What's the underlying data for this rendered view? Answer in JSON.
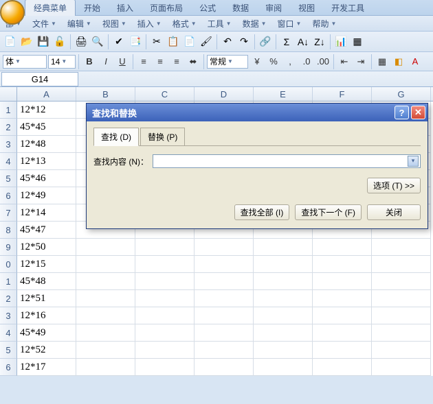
{
  "ribbon_tabs": [
    "经典菜单",
    "开始",
    "插入",
    "页面布局",
    "公式",
    "数据",
    "审阅",
    "视图",
    "开发工具"
  ],
  "active_ribbon_tab": 0,
  "menu": {
    "all": "部",
    "file": "文件",
    "edit": "编辑",
    "view": "视图",
    "insert": "插入",
    "format": "格式",
    "tools": "工具",
    "data": "数据",
    "window": "窗口",
    "help": "帮助"
  },
  "format_bar": {
    "font": "体",
    "size": "14",
    "style_combo": "常规"
  },
  "name_box": "G14",
  "columns": [
    "A",
    "B",
    "C",
    "D",
    "E",
    "F",
    "G"
  ],
  "rows": [
    {
      "n": "1",
      "a": "12*12"
    },
    {
      "n": "2",
      "a": "45*45"
    },
    {
      "n": "3",
      "a": "12*48"
    },
    {
      "n": "4",
      "a": "12*13"
    },
    {
      "n": "5",
      "a": "45*46"
    },
    {
      "n": "6",
      "a": "12*49"
    },
    {
      "n": "7",
      "a": "12*14"
    },
    {
      "n": "8",
      "a": "45*47"
    },
    {
      "n": "9",
      "a": "12*50"
    },
    {
      "n": "0",
      "a": "12*15"
    },
    {
      "n": "1",
      "a": "45*48"
    },
    {
      "n": "2",
      "a": "12*51"
    },
    {
      "n": "3",
      "a": "12*16"
    },
    {
      "n": "4",
      "a": "45*49"
    },
    {
      "n": "5",
      "a": "12*52"
    },
    {
      "n": "6",
      "a": "12*17"
    }
  ],
  "dialog": {
    "title": "查找和替换",
    "tab_find": "查找 (D)",
    "tab_replace": "替换 (P)",
    "find_label": "查找内容 (N)：",
    "options_btn": "选项 (T) >>",
    "find_all_btn": "查找全部 (I)",
    "find_next_btn": "查找下一个 (F)",
    "close_btn": "关闭"
  }
}
